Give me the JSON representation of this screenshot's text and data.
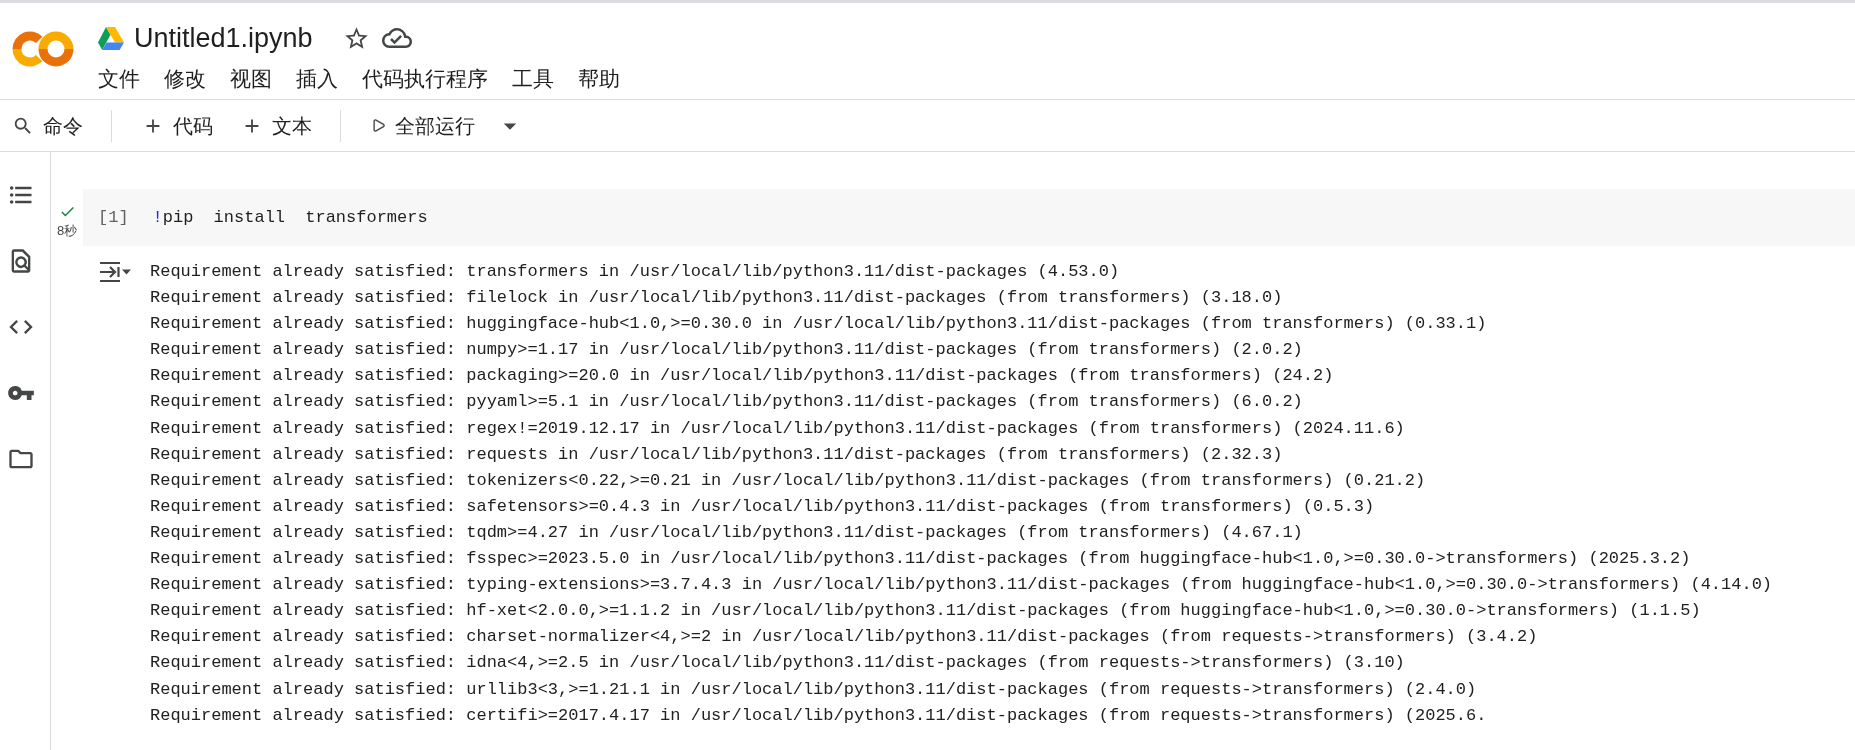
{
  "notebook": {
    "title": "Untitled1.ipynb"
  },
  "menu": [
    "文件",
    "修改",
    "视图",
    "插入",
    "代码执行程序",
    "工具",
    "帮助"
  ],
  "toolbar": {
    "groups": [
      [
        {
          "kind": "search",
          "label": "命令"
        }
      ],
      [
        {
          "kind": "add",
          "label": "代码"
        },
        {
          "kind": "add",
          "label": "文本"
        }
      ],
      [
        {
          "kind": "run",
          "label": "全部运行",
          "dropdown": true
        }
      ]
    ]
  },
  "cell": {
    "succeeded": true,
    "duration": "8秒",
    "execution_count": "[1]",
    "code": [
      {
        "kind": "bang",
        "text": "!"
      },
      {
        "kind": "plain",
        "text": "pip install transformers"
      }
    ],
    "output": [
      "Requirement already satisfied: transformers in /usr/local/lib/python3.11/dist-packages (4.53.0)",
      "Requirement already satisfied: filelock in /usr/local/lib/python3.11/dist-packages (from transformers) (3.18.0)",
      "Requirement already satisfied: huggingface-hub<1.0,>=0.30.0 in /usr/local/lib/python3.11/dist-packages (from transformers) (0.33.1)",
      "Requirement already satisfied: numpy>=1.17 in /usr/local/lib/python3.11/dist-packages (from transformers) (2.0.2)",
      "Requirement already satisfied: packaging>=20.0 in /usr/local/lib/python3.11/dist-packages (from transformers) (24.2)",
      "Requirement already satisfied: pyyaml>=5.1 in /usr/local/lib/python3.11/dist-packages (from transformers) (6.0.2)",
      "Requirement already satisfied: regex!=2019.12.17 in /usr/local/lib/python3.11/dist-packages (from transformers) (2024.11.6)",
      "Requirement already satisfied: requests in /usr/local/lib/python3.11/dist-packages (from transformers) (2.32.3)",
      "Requirement already satisfied: tokenizers<0.22,>=0.21 in /usr/local/lib/python3.11/dist-packages (from transformers) (0.21.2)",
      "Requirement already satisfied: safetensors>=0.4.3 in /usr/local/lib/python3.11/dist-packages (from transformers) (0.5.3)",
      "Requirement already satisfied: tqdm>=4.27 in /usr/local/lib/python3.11/dist-packages (from transformers) (4.67.1)",
      "Requirement already satisfied: fsspec>=2023.5.0 in /usr/local/lib/python3.11/dist-packages (from huggingface-hub<1.0,>=0.30.0->transformers) (2025.3.2)",
      "Requirement already satisfied: typing-extensions>=3.7.4.3 in /usr/local/lib/python3.11/dist-packages (from huggingface-hub<1.0,>=0.30.0->transformers) (4.14.0)",
      "Requirement already satisfied: hf-xet<2.0.0,>=1.1.2 in /usr/local/lib/python3.11/dist-packages (from huggingface-hub<1.0,>=0.30.0->transformers) (1.1.5)",
      "Requirement already satisfied: charset-normalizer<4,>=2 in /usr/local/lib/python3.11/dist-packages (from requests->transformers) (3.4.2)",
      "Requirement already satisfied: idna<4,>=2.5 in /usr/local/lib/python3.11/dist-packages (from requests->transformers) (3.10)",
      "Requirement already satisfied: urllib3<3,>=1.21.1 in /usr/local/lib/python3.11/dist-packages (from requests->transformers) (2.4.0)",
      "Requirement already satisfied: certifi>=2017.4.17 in /usr/local/lib/python3.11/dist-packages (from requests->transformers) (2025.6."
    ]
  }
}
